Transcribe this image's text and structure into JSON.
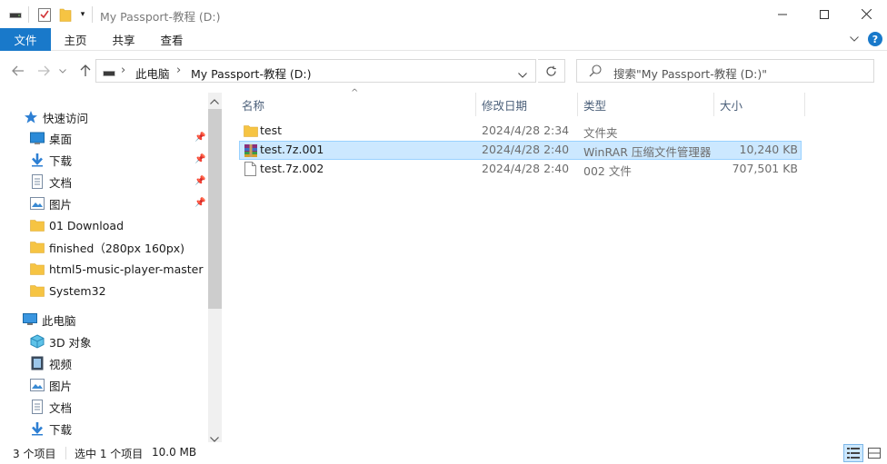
{
  "window": {
    "title": "My Passport-教程 (D:)",
    "controls": {
      "minimize": "—",
      "maximize": "☐",
      "close": "✕"
    }
  },
  "ribbon": {
    "tabs": [
      "文件",
      "主页",
      "共享",
      "查看"
    ],
    "collapse_glyph": "⌵",
    "help_glyph": "?"
  },
  "address": {
    "back": "←",
    "forward": "→",
    "recent": "⌄",
    "up": "↑",
    "segments": [
      "此电脑",
      "My Passport-教程 (D:)"
    ],
    "separator": "›",
    "dropdown": "⌄",
    "refresh": "↻"
  },
  "search": {
    "placeholder": "搜索\"My Passport-教程 (D:)\""
  },
  "sidebar": {
    "quick_access": "快速访问",
    "pinned": [
      {
        "label": "桌面",
        "icon": "desktop-icon"
      },
      {
        "label": "下载",
        "icon": "download-icon"
      },
      {
        "label": "文档",
        "icon": "document-icon"
      },
      {
        "label": "图片",
        "icon": "picture-icon"
      }
    ],
    "folders": [
      {
        "label": "01 Download"
      },
      {
        "label": "finished（280px 160px)"
      },
      {
        "label": "html5-music-player-master"
      },
      {
        "label": "System32"
      }
    ],
    "this_pc": "此电脑",
    "pc_items": [
      {
        "label": "3D 对象",
        "icon": "3d-objects-icon"
      },
      {
        "label": "视频",
        "icon": "video-icon"
      },
      {
        "label": "图片",
        "icon": "picture-icon"
      },
      {
        "label": "文档",
        "icon": "document-icon"
      },
      {
        "label": "下载",
        "icon": "download-icon"
      }
    ]
  },
  "columns": {
    "name": "名称",
    "modified": "修改日期",
    "type": "类型",
    "size": "大小",
    "sort_glyph": "^"
  },
  "files": [
    {
      "name": "test",
      "modified": "2024/4/28 2:34",
      "type": "文件夹",
      "size": "",
      "icon": "folder-icon",
      "selected": false
    },
    {
      "name": "test.7z.001",
      "modified": "2024/4/28 2:40",
      "type": "WinRAR 压缩文件管理器",
      "size": "10,240 KB",
      "icon": "winrar-archive-icon",
      "selected": true
    },
    {
      "name": "test.7z.002",
      "modified": "2024/4/28 2:40",
      "type": "002 文件",
      "size": "707,501 KB",
      "icon": "blank-file-icon",
      "selected": false
    }
  ],
  "statusbar": {
    "item_count": "3 个项目",
    "selection": "选中 1 个项目",
    "selection_size": "10.0 MB"
  },
  "colors": {
    "accent": "#1979ca",
    "selection_bg": "#cce8ff",
    "selection_border": "#99d1ff",
    "folder": "#f6c443"
  }
}
